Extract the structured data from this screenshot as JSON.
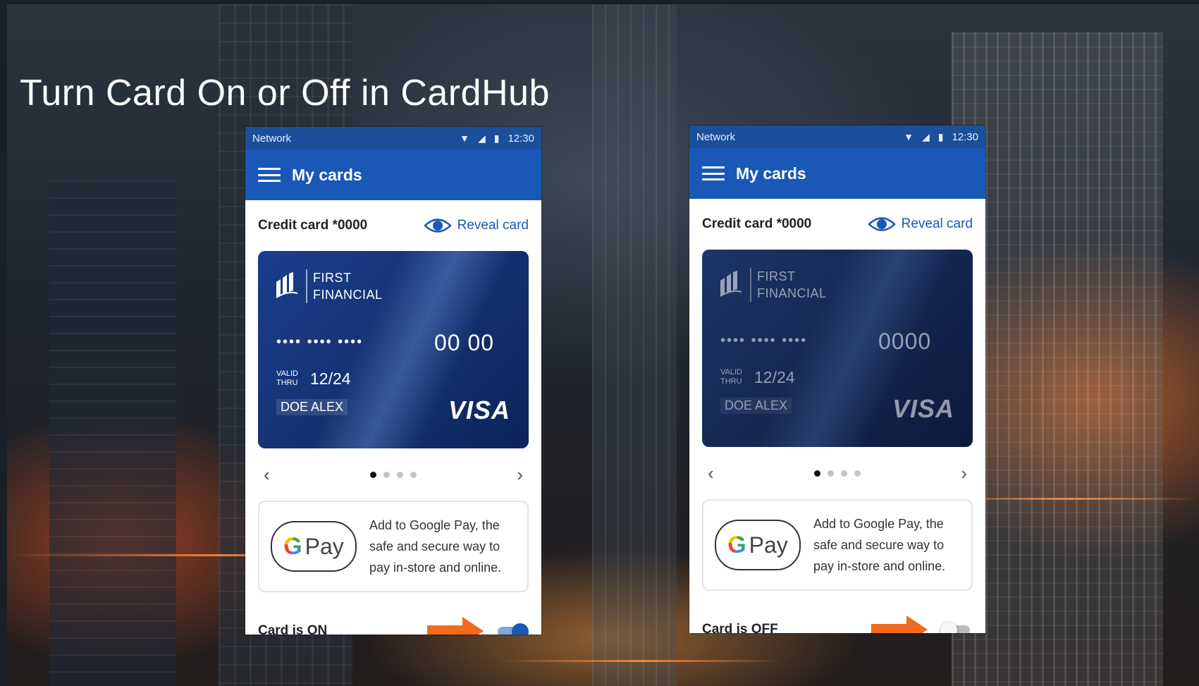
{
  "title": "Turn Card On or Off in CardHub",
  "colors": {
    "app_bar": "#1a58b7",
    "status_bar": "#1b4e9b",
    "accent": "#1a58b7",
    "arrow": "#f26b1d"
  },
  "left_phone": {
    "status": {
      "network": "Network",
      "time": "12:30"
    },
    "app_bar": {
      "title": "My cards",
      "menu_icon": "hamburger-icon"
    },
    "card_label": "Credit card *0000",
    "reveal_label": "Reveal card",
    "card": {
      "bank_line1": "FIRST",
      "bank_line2": "FINANCIAL",
      "masked_number": "•••• •••• ••••",
      "last_digits": "00 00",
      "valid_label_1": "VALID",
      "valid_label_2": "THRU",
      "expiry": "12/24",
      "holder": "DOE ALEX",
      "brand": "VISA"
    },
    "pager": {
      "prev": "‹",
      "next": "›",
      "pages": 4,
      "active": 1
    },
    "gpay": {
      "g": "G",
      "pay": "Pay",
      "line1": "Add to Google Pay, the",
      "line2": "safe and secure way to",
      "line3": "pay in-store and online."
    },
    "card_state_label": "Card is ON",
    "toggle_on": true
  },
  "right_phone": {
    "status": {
      "network": "Network",
      "time": "12:30"
    },
    "app_bar": {
      "title": "My cards",
      "menu_icon": "hamburger-icon"
    },
    "card_label": "Credit card *0000",
    "reveal_label": "Reveal card",
    "card": {
      "bank_line1": "FIRST",
      "bank_line2": "FINANCIAL",
      "masked_number": "•••• •••• ••••",
      "last_digits": "0000",
      "valid_label_1": "VALID",
      "valid_label_2": "THRU",
      "expiry": "12/24",
      "holder": "DOE ALEX",
      "brand": "VISA"
    },
    "pager": {
      "prev": "‹",
      "next": "›",
      "pages": 4,
      "active": 1
    },
    "gpay": {
      "g": "G",
      "pay": "Pay",
      "line1": "Add to Google Pay, the",
      "line2": "safe and secure way to",
      "line3": "pay in-store and online."
    },
    "card_state_label": "Card is OFF",
    "toggle_on": false
  }
}
